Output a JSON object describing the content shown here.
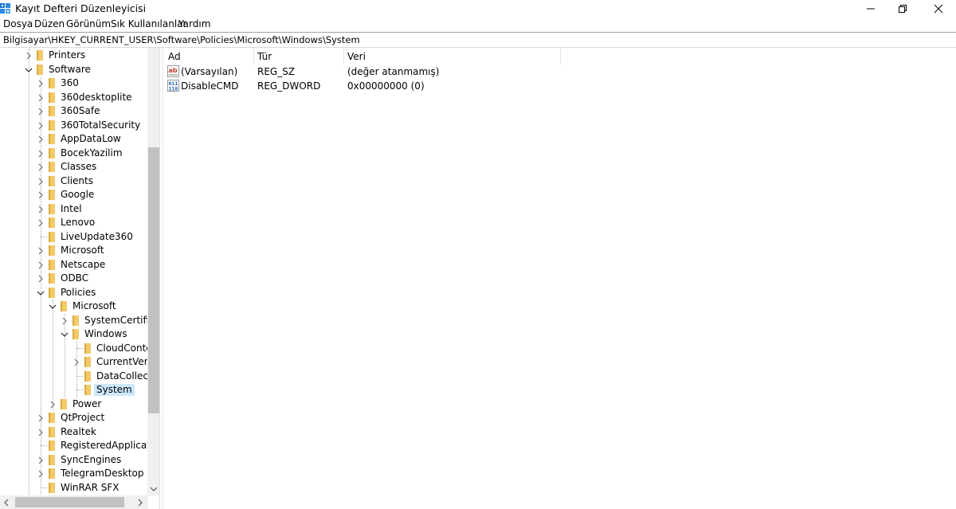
{
  "window": {
    "title": "Kayıt Defteri Düzenleyicisi",
    "icon": "registry-editor-icon"
  },
  "menu": [
    "Dosya",
    "Düzen",
    "Görünüm",
    "Sık Kullanılanlar",
    "Yardım"
  ],
  "address": "Bilgisayar\\HKEY_CURRENT_USER\\Software\\Policies\\Microsoft\\Windows\\System",
  "tree": {
    "nodes": [
      {
        "label": "Printers",
        "expander": "collapsed"
      },
      {
        "label": "Software",
        "expander": "expanded"
      },
      {
        "label": "360",
        "expander": "collapsed"
      },
      {
        "label": "360desktoplite",
        "expander": "collapsed"
      },
      {
        "label": "360Safe",
        "expander": "collapsed"
      },
      {
        "label": "360TotalSecurity",
        "expander": "collapsed"
      },
      {
        "label": "AppDataLow",
        "expander": "collapsed"
      },
      {
        "label": "BocekYazilim",
        "expander": "collapsed"
      },
      {
        "label": "Classes",
        "expander": "collapsed"
      },
      {
        "label": "Clients",
        "expander": "collapsed"
      },
      {
        "label": "Google",
        "expander": "collapsed"
      },
      {
        "label": "Intel",
        "expander": "collapsed"
      },
      {
        "label": "Lenovo",
        "expander": "collapsed"
      },
      {
        "label": "LiveUpdate360",
        "expander": "none"
      },
      {
        "label": "Microsoft",
        "expander": "collapsed"
      },
      {
        "label": "Netscape",
        "expander": "collapsed"
      },
      {
        "label": "ODBC",
        "expander": "collapsed"
      },
      {
        "label": "Policies",
        "expander": "expanded"
      },
      {
        "label": "Microsoft",
        "expander": "expanded"
      },
      {
        "label": "SystemCertificates",
        "expander": "collapsed"
      },
      {
        "label": "Windows",
        "expander": "expanded"
      },
      {
        "label": "CloudContent",
        "expander": "none"
      },
      {
        "label": "CurrentVersion",
        "expander": "collapsed"
      },
      {
        "label": "DataCollection",
        "expander": "none"
      },
      {
        "label": "System",
        "expander": "none",
        "selected": true
      },
      {
        "label": "Power",
        "expander": "collapsed"
      },
      {
        "label": "QtProject",
        "expander": "collapsed"
      },
      {
        "label": "Realtek",
        "expander": "collapsed"
      },
      {
        "label": "RegisteredApplications",
        "expander": "none"
      },
      {
        "label": "SyncEngines",
        "expander": "collapsed"
      },
      {
        "label": "TelegramDesktop",
        "expander": "collapsed"
      },
      {
        "label": "WinRAR SFX",
        "expander": "none"
      }
    ]
  },
  "list": {
    "columns": [
      "Ad",
      "Tür",
      "Veri"
    ],
    "rows": [
      {
        "icon": "string-value-icon",
        "name": "(Varsayılan)",
        "type": "REG_SZ",
        "data": "(değer atanmamış)"
      },
      {
        "icon": "binary-value-icon",
        "name": "DisableCMD",
        "type": "REG_DWORD",
        "data": "0x00000000 (0)"
      }
    ]
  },
  "colors": {
    "selection": "#cce8ff",
    "folder": "#f3c969",
    "folder_dark": "#dcaa3c"
  }
}
